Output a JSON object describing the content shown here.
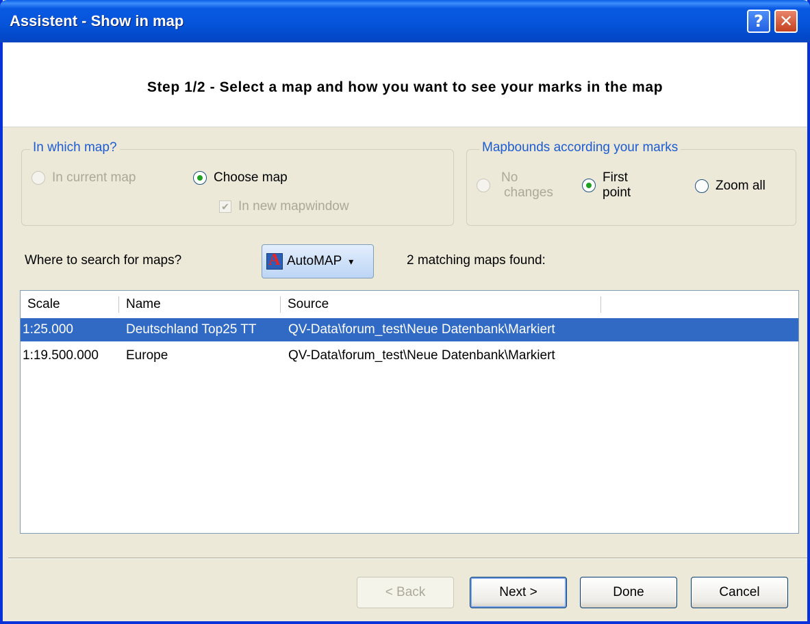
{
  "window": {
    "title": "Assistent - Show in map",
    "help_glyph": "?",
    "close_glyph": "✕"
  },
  "header": {
    "step_title": "Step 1/2 - Select a map and how you want to see your marks in the map"
  },
  "map_group": {
    "legend": "In which map?",
    "option_current": "In current map",
    "option_choose": "Choose map",
    "checkbox_new_window": "In new mapwindow"
  },
  "bounds_group": {
    "legend": "Mapbounds according your marks",
    "option_no_changes_line1": "No",
    "option_no_changes_line2": "changes",
    "option_first_point_line1": "First",
    "option_first_point_line2": "point",
    "option_zoom_all": "Zoom all"
  },
  "search": {
    "label": "Where to search for maps?",
    "source_button": "AutoMAP",
    "dropdown_glyph": "▾",
    "result_text": "2 matching maps found:"
  },
  "table": {
    "headers": [
      "Scale",
      "Name",
      "Source"
    ],
    "rows": [
      {
        "scale": "1:25.000",
        "name": "Deutschland Top25 TT",
        "source": "QV-Data\\forum_test\\Neue Datenbank\\Markiert"
      },
      {
        "scale": "1:19.500.000",
        "name": "Europe",
        "source": "QV-Data\\forum_test\\Neue Datenbank\\Markiert"
      }
    ]
  },
  "buttons": {
    "back": "< Back",
    "next": "Next >",
    "done": "Done",
    "cancel": "Cancel"
  }
}
